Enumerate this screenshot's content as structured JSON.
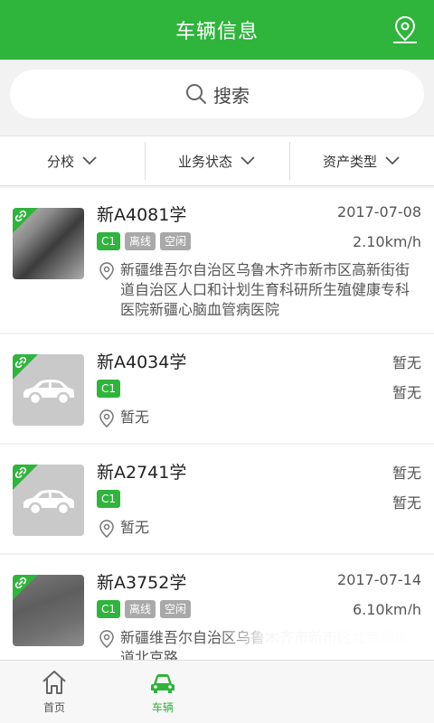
{
  "header": {
    "title": "车辆信息"
  },
  "search": {
    "label": "搜索"
  },
  "filters": [
    {
      "label": "分校"
    },
    {
      "label": "业务状态"
    },
    {
      "label": "资产类型"
    }
  ],
  "vehicles": [
    {
      "plate": "新A4081学",
      "date": "2017-07-08",
      "speed": "2.10km/h",
      "tags": [
        "C1",
        "离线",
        "空闲"
      ],
      "address": "新疆维吾尔自治区乌鲁木齐市新市区高新街街道自治区人口和计划生育科研所生殖健康专科医院新疆心脑血管病医院"
    },
    {
      "plate": "新A4034学",
      "date": "暂无",
      "speed": "暂无",
      "tags": [
        "C1"
      ],
      "address": "暂无"
    },
    {
      "plate": "新A2741学",
      "date": "暂无",
      "speed": "暂无",
      "tags": [
        "C1"
      ],
      "address": "暂无"
    },
    {
      "plate": "新A3752学",
      "date": "2017-07-14",
      "speed": "6.10km/h",
      "tags": [
        "C1",
        "离线",
        "空闲"
      ],
      "address": "新疆维吾尔自治区乌鲁木齐市新市区北京路街道北京路"
    }
  ],
  "tabbar": [
    {
      "label": "首页"
    },
    {
      "label": "车辆"
    }
  ],
  "colors": {
    "accent": "#2fb43c"
  }
}
